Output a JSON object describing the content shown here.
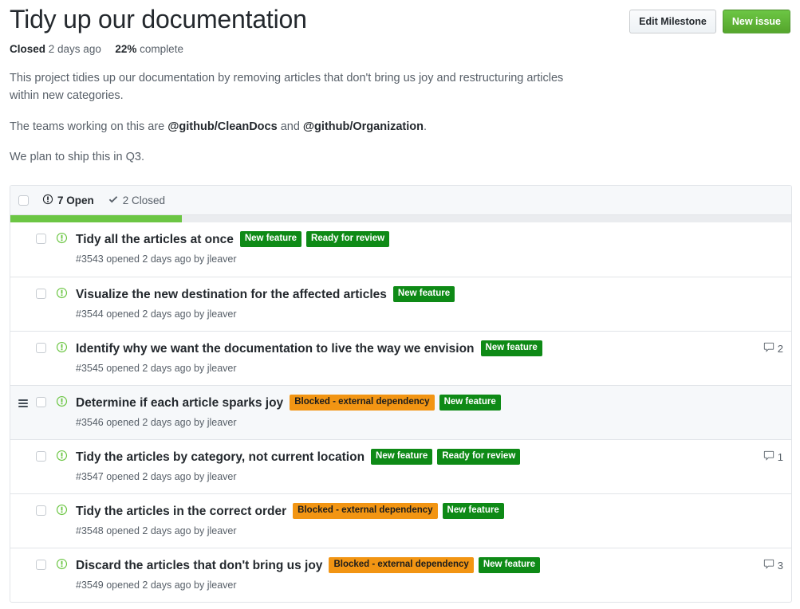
{
  "header": {
    "title": "Tidy up our documentation",
    "state": "Closed",
    "state_time": "2 days ago",
    "percent": "22%",
    "percent_suffix": "complete",
    "progress_value": 22,
    "edit_button": "Edit Milestone",
    "new_issue_button": "New issue"
  },
  "description": {
    "p1_a": "This project tidies up our documentation by removing articles that don't bring us joy and restructuring articles within new categories.",
    "p2_pre": "The teams working on this are ",
    "p2_team1": "@github/CleanDocs",
    "p2_mid": " and ",
    "p2_team2": "@github/Organization",
    "p2_post": ".",
    "p3": "We plan to ship this in Q3."
  },
  "list_header": {
    "open_count": "7 Open",
    "closed_count": "2 Closed"
  },
  "colors": {
    "green_label": "#0e8a16",
    "orange_label": "#f29513",
    "progress_green": "#6cc644",
    "primary_button": "#6cc644"
  },
  "labels": {
    "new_feature": {
      "text": "New feature",
      "bg": "#0e8a16",
      "fg": "#ffffff"
    },
    "ready_for_review": {
      "text": "Ready for review",
      "bg": "#0e8a16",
      "fg": "#ffffff"
    },
    "blocked": {
      "text": "Blocked - external dependency",
      "bg": "#f29513",
      "fg": "#1c1c1c"
    }
  },
  "issues": [
    {
      "title": "Tidy all the articles at once",
      "meta": "#3543 opened 2 days ago by jleaver",
      "labels": [
        "new_feature",
        "ready_for_review"
      ],
      "comments": "",
      "highlighted": false,
      "drag_handle": false
    },
    {
      "title": "Visualize the new destination for the affected articles",
      "meta": "#3544 opened 2 days ago by jleaver",
      "labels": [
        "new_feature"
      ],
      "comments": "",
      "highlighted": false,
      "drag_handle": false
    },
    {
      "title": "Identify why we want the documentation to live the way we envision",
      "meta": "#3545 opened 2 days ago by jleaver",
      "labels": [
        "new_feature"
      ],
      "comments": "2",
      "highlighted": false,
      "drag_handle": false
    },
    {
      "title": "Determine if each article sparks joy",
      "meta": "#3546 opened 2 days ago by jleaver",
      "labels": [
        "blocked",
        "new_feature"
      ],
      "comments": "",
      "highlighted": true,
      "drag_handle": true
    },
    {
      "title": "Tidy the articles by category, not current location",
      "meta": "#3547 opened 2 days ago by jleaver",
      "labels": [
        "new_feature",
        "ready_for_review"
      ],
      "comments": "1",
      "highlighted": false,
      "drag_handle": false
    },
    {
      "title": "Tidy the articles in the correct order",
      "meta": "#3548 opened 2 days ago by jleaver",
      "labels": [
        "blocked",
        "new_feature"
      ],
      "comments": "",
      "highlighted": false,
      "drag_handle": false
    },
    {
      "title": "Discard the articles that don't bring us joy",
      "meta": "#3549 opened 2 days ago by jleaver",
      "labels": [
        "blocked",
        "new_feature"
      ],
      "comments": "3",
      "highlighted": false,
      "drag_handle": false
    }
  ]
}
